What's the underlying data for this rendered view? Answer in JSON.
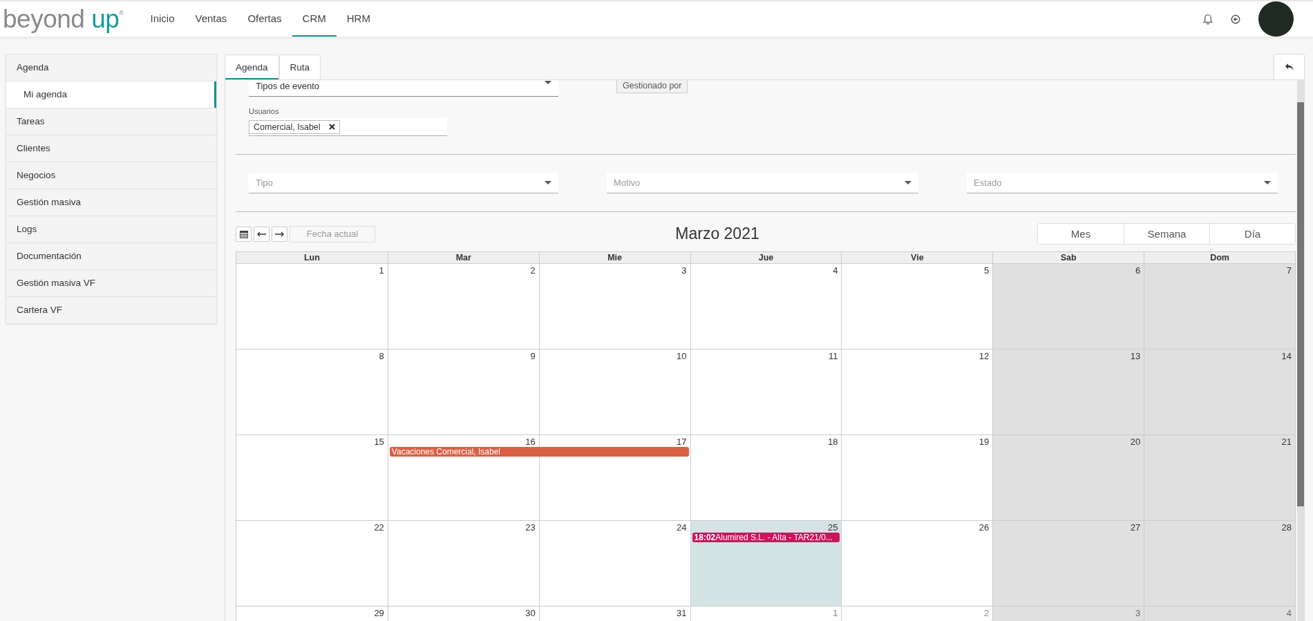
{
  "logo": {
    "word_1": "beyond",
    "word_2": "up",
    "mark": "®"
  },
  "nav": [
    {
      "label": "Inicio",
      "selected": false
    },
    {
      "label": "Ventas",
      "selected": false
    },
    {
      "label": "Ofertas",
      "selected": false
    },
    {
      "label": "CRM",
      "selected": true
    },
    {
      "label": "HRM",
      "selected": false
    }
  ],
  "sidebar": {
    "items": [
      {
        "label": "Agenda",
        "selected": false,
        "children": [
          {
            "label": "Mi agenda",
            "selected": true
          }
        ]
      },
      {
        "label": "Tareas",
        "selected": false
      },
      {
        "label": "Clientes",
        "selected": false
      },
      {
        "label": "Negocios",
        "selected": false
      },
      {
        "label": "Gestión masiva",
        "selected": false
      },
      {
        "label": "Logs",
        "selected": false
      },
      {
        "label": "Documentación",
        "selected": false
      },
      {
        "label": "Gestión masiva VF",
        "selected": false
      },
      {
        "label": "Cartera VF",
        "selected": false
      }
    ]
  },
  "tabs": [
    {
      "label": "Agenda",
      "selected": true
    },
    {
      "label": "Ruta",
      "selected": false
    }
  ],
  "filters": {
    "event_types": {
      "label": "Tipos de evento"
    },
    "managed_by_button": "Gestionado por",
    "users": {
      "label": "Usuarios",
      "tags": [
        "Comercial, Isabel"
      ]
    },
    "dropdowns": [
      {
        "placeholder": "Tipo"
      },
      {
        "placeholder": "Motivo"
      },
      {
        "placeholder": "Estado"
      }
    ]
  },
  "calendar": {
    "title": "Marzo 2021",
    "today_button": "Fecha actual",
    "views": [
      "Mes",
      "Semana",
      "Día"
    ],
    "weekdays": [
      {
        "label": "Lun",
        "weekend": false
      },
      {
        "label": "Mar",
        "weekend": false
      },
      {
        "label": "Mie",
        "weekend": false
      },
      {
        "label": "Jue",
        "weekend": false
      },
      {
        "label": "Vie",
        "weekend": false
      },
      {
        "label": "Sab",
        "weekend": true
      },
      {
        "label": "Dom",
        "weekend": true
      }
    ],
    "weeks": [
      {
        "days": [
          {
            "day": "1",
            "other_month": false,
            "today": false
          },
          {
            "day": "2",
            "other_month": false,
            "today": false
          },
          {
            "day": "3",
            "other_month": false,
            "today": false
          },
          {
            "day": "4",
            "other_month": false,
            "today": false
          },
          {
            "day": "5",
            "other_month": false,
            "today": false
          },
          {
            "day": "6",
            "other_month": false,
            "today": false
          },
          {
            "day": "7",
            "other_month": false,
            "today": false
          }
        ]
      },
      {
        "days": [
          {
            "day": "8",
            "other_month": false,
            "today": false
          },
          {
            "day": "9",
            "other_month": false,
            "today": false
          },
          {
            "day": "10",
            "other_month": false,
            "today": false
          },
          {
            "day": "11",
            "other_month": false,
            "today": false
          },
          {
            "day": "12",
            "other_month": false,
            "today": false
          },
          {
            "day": "13",
            "other_month": false,
            "today": false
          },
          {
            "day": "14",
            "other_month": false,
            "today": false
          }
        ]
      },
      {
        "days": [
          {
            "day": "15",
            "other_month": false,
            "today": false
          },
          {
            "day": "16",
            "other_month": false,
            "today": false,
            "events": [
              {
                "kind": "all-day-start",
                "title": "Vacaciones Comercial, Isabel",
                "color": "#d95f45"
              }
            ]
          },
          {
            "day": "17",
            "other_month": false,
            "today": false,
            "events": [
              {
                "kind": "all-day-end",
                "color": "#d95f45"
              }
            ]
          },
          {
            "day": "18",
            "other_month": false,
            "today": false
          },
          {
            "day": "19",
            "other_month": false,
            "today": false
          },
          {
            "day": "20",
            "other_month": false,
            "today": false
          },
          {
            "day": "21",
            "other_month": false,
            "today": false
          }
        ]
      },
      {
        "days": [
          {
            "day": "22",
            "other_month": false,
            "today": false
          },
          {
            "day": "23",
            "other_month": false,
            "today": false
          },
          {
            "day": "24",
            "other_month": false,
            "today": false
          },
          {
            "day": "25",
            "other_month": false,
            "today": true,
            "events": [
              {
                "kind": "timed",
                "time": "18:02",
                "title": "Alumired S.L. - Alta - TAR21/0...",
                "color": "#c8175d"
              }
            ]
          },
          {
            "day": "26",
            "other_month": false,
            "today": false
          },
          {
            "day": "27",
            "other_month": false,
            "today": false
          },
          {
            "day": "28",
            "other_month": false,
            "today": false
          }
        ]
      },
      {
        "days": [
          {
            "day": "29",
            "other_month": false,
            "today": false
          },
          {
            "day": "30",
            "other_month": false,
            "today": false
          },
          {
            "day": "31",
            "other_month": false,
            "today": false
          },
          {
            "day": "1",
            "other_month": true,
            "today": false
          },
          {
            "day": "2",
            "other_month": true,
            "today": false
          },
          {
            "day": "3",
            "other_month": true,
            "today": false
          },
          {
            "day": "4",
            "other_month": true,
            "today": false
          }
        ]
      }
    ]
  }
}
